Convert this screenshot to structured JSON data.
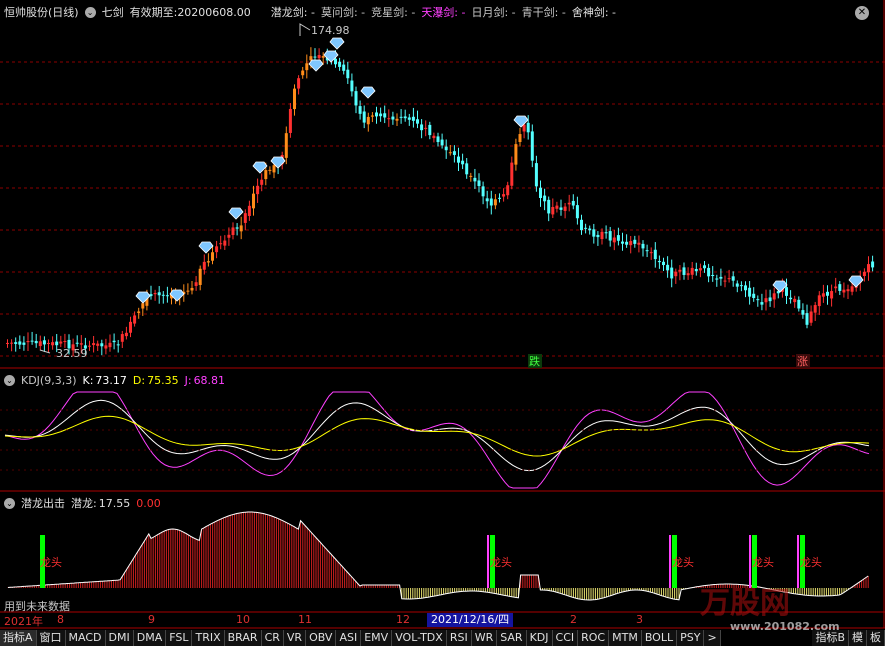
{
  "header": {
    "stock": "恒帅股份(日线)",
    "indicator": "七剑",
    "validity_label": "有效期至:",
    "validity_date": "20200608.00",
    "swords": [
      {
        "name": "潜龙剑:",
        "val": "-",
        "color": "#e0e0e0"
      },
      {
        "name": "莫问剑:",
        "val": "-",
        "color": "#c8c8c8"
      },
      {
        "name": "竞星剑:",
        "val": "-",
        "color": "#c8c8c8"
      },
      {
        "name": "天瀑剑:",
        "val": "-",
        "color": "#ff40ff"
      },
      {
        "name": "日月剑:",
        "val": "-",
        "color": "#c8c8c8"
      },
      {
        "name": "青干剑:",
        "val": "-",
        "color": "#c8c8c8"
      },
      {
        "name": "舍神剑:",
        "val": "-",
        "color": "#e0e0e0"
      }
    ]
  },
  "price": {
    "high_label": "174.98",
    "low_label": "32.59",
    "down_tag": "跌",
    "up_tag": "涨"
  },
  "kdj": {
    "title": "KDJ(9,3,3)",
    "k_label": "K:",
    "k": "73.17",
    "d_label": "D:",
    "d": "75.35",
    "j_label": "J:",
    "j": "68.81"
  },
  "qianlong": {
    "title": "潜龙出击",
    "name_label": "潜龙:",
    "value": "17.55",
    "extra": "0.00",
    "marker": "龙头",
    "future_note": "用到未来数据"
  },
  "date_axis": {
    "year": "2021年",
    "months": [
      "8",
      "9",
      "10",
      "11",
      "12",
      "2",
      "3"
    ],
    "cursor": "2021/12/16/四"
  },
  "tabs": [
    "指标A",
    "窗口",
    "MACD",
    "DMI",
    "DMA",
    "FSL",
    "TRIX",
    "BRAR",
    "CR",
    "VR",
    "OBV",
    "ASI",
    "EMV",
    "VOL-TDX",
    "RSI",
    "WR",
    "SAR",
    "KDJ",
    "CCI",
    "ROC",
    "MTM",
    "BOLL",
    "PSY",
    ">",
    "指标B",
    "模",
    "板"
  ],
  "watermark": {
    "brand": "万股网",
    "site": "www.201082.com"
  },
  "colors": {
    "up": "#ff3030",
    "down": "#54ffff",
    "accent_up": "#ff8c1a",
    "k": "#ffffff",
    "d": "#ffff00",
    "j": "#ff40ff",
    "grid": "#8b0000"
  }
}
